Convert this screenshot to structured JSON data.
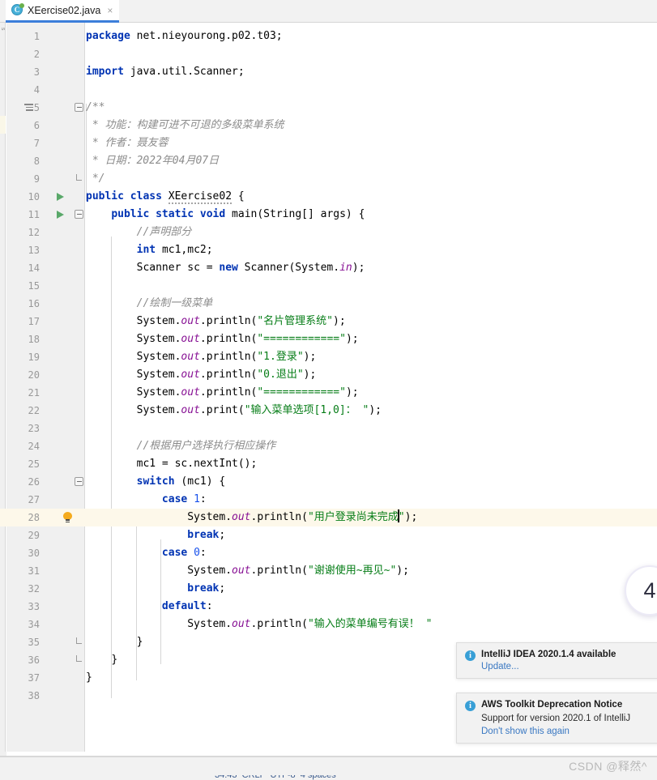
{
  "window": {
    "app": "IntelliJ IDEA"
  },
  "tab": {
    "icon": "java-class-icon",
    "label": "XEercise02.java",
    "close": "×"
  },
  "left_strip": {
    "vertical_text": "s"
  },
  "editor": {
    "current_line": 28,
    "lines": [
      {
        "n": 1,
        "html": "<span class=\"kw\">package</span> <span class=\"pln\">net.nieyourong.p02.t03;</span>"
      },
      {
        "n": 2,
        "html": ""
      },
      {
        "n": 3,
        "html": "<span class=\"kw\">import</span> <span class=\"pln\">java.util.Scanner;</span>"
      },
      {
        "n": 4,
        "html": ""
      },
      {
        "n": 5,
        "html": "<span class=\"cmt\">/**</span>"
      },
      {
        "n": 6,
        "html": "<span class=\"cmt\"> * 功能：构建可进不可退的多级菜单系统</span>"
      },
      {
        "n": 7,
        "html": "<span class=\"cmt\"> * 作者：聂友蓉</span>"
      },
      {
        "n": 8,
        "html": "<span class=\"cmt\"> * 日期：2022年04月07日</span>"
      },
      {
        "n": 9,
        "html": "<span class=\"cmt\"> */</span>"
      },
      {
        "n": 10,
        "html": "<span class=\"kw\">public</span> <span class=\"kw\">class</span> <span class=\"pln wavy\">XEercise02</span> <span class=\"pln\">{</span>"
      },
      {
        "n": 11,
        "html": "    <span class=\"kw\">public</span> <span class=\"kw\">static</span> <span class=\"kw\">void</span> <span class=\"pln\">main(String[] args) {</span>"
      },
      {
        "n": 12,
        "html": "        <span class=\"cmt\">//声明部分</span>"
      },
      {
        "n": 13,
        "html": "        <span class=\"kw\">int</span> <span class=\"pln\">mc1,mc2;</span>"
      },
      {
        "n": 14,
        "html": "        <span class=\"pln\">Scanner sc = </span><span class=\"kw\">new</span><span class=\"pln\"> Scanner(System.</span><span class=\"fld\">in</span><span class=\"pln\">);</span>"
      },
      {
        "n": 15,
        "html": ""
      },
      {
        "n": 16,
        "html": "        <span class=\"cmt\">//绘制一级菜单</span>"
      },
      {
        "n": 17,
        "html": "        <span class=\"pln\">System.</span><span class=\"fld\">out</span><span class=\"pln\">.println(</span><span class=\"str\">\"名片管理系统\"</span><span class=\"pln\">);</span>"
      },
      {
        "n": 18,
        "html": "        <span class=\"pln\">System.</span><span class=\"fld\">out</span><span class=\"pln\">.println(</span><span class=\"str\">\"============\"</span><span class=\"pln\">);</span>"
      },
      {
        "n": 19,
        "html": "        <span class=\"pln\">System.</span><span class=\"fld\">out</span><span class=\"pln\">.println(</span><span class=\"str\">\"1.登录\"</span><span class=\"pln\">);</span>"
      },
      {
        "n": 20,
        "html": "        <span class=\"pln\">System.</span><span class=\"fld\">out</span><span class=\"pln\">.println(</span><span class=\"str\">\"0.退出\"</span><span class=\"pln\">);</span>"
      },
      {
        "n": 21,
        "html": "        <span class=\"pln\">System.</span><span class=\"fld\">out</span><span class=\"pln\">.println(</span><span class=\"str\">\"============\"</span><span class=\"pln\">);</span>"
      },
      {
        "n": 22,
        "html": "        <span class=\"pln\">System.</span><span class=\"fld\">out</span><span class=\"pln\">.print(</span><span class=\"str\">\"输入菜单选项[1,0]： \"</span><span class=\"pln\">);</span>"
      },
      {
        "n": 23,
        "html": ""
      },
      {
        "n": 24,
        "html": "        <span class=\"cmt\">//根据用户选择执行相应操作</span>"
      },
      {
        "n": 25,
        "html": "        <span class=\"pln\">mc1 = sc.nextInt();</span>"
      },
      {
        "n": 26,
        "html": "        <span class=\"kw\">switch</span> <span class=\"pln\">(mc1) {</span>"
      },
      {
        "n": 27,
        "html": "            <span class=\"kw\">case</span> <span class=\"num\">1</span><span class=\"pln\">:</span>"
      },
      {
        "n": 28,
        "html": "                <span class=\"pln\">System.</span><span class=\"fld\">out</span><span class=\"pln\">.println(</span><span class=\"str\">\"用户登录尚未完成</span><span class=\"caret\"></span><span class=\"str\">\"</span><span class=\"pln\">);</span>"
      },
      {
        "n": 29,
        "html": "                <span class=\"kw\">break</span><span class=\"pln\">;</span>"
      },
      {
        "n": 30,
        "html": "            <span class=\"kw\">case</span> <span class=\"num\">0</span><span class=\"pln\">:</span>"
      },
      {
        "n": 31,
        "html": "                <span class=\"pln\">System.</span><span class=\"fld\">out</span><span class=\"pln\">.println(</span><span class=\"str\">\"谢谢使用~再见~\"</span><span class=\"pln\">);</span>"
      },
      {
        "n": 32,
        "html": "                <span class=\"kw\">break</span><span class=\"pln\">;</span>"
      },
      {
        "n": 33,
        "html": "            <span class=\"kw\">default</span><span class=\"pln\">:</span>"
      },
      {
        "n": 34,
        "html": "                <span class=\"pln\">System.</span><span class=\"fld\">out</span><span class=\"pln\">.println(</span><span class=\"str\">\"输入的菜单编号有误！ \"</span>"
      },
      {
        "n": 35,
        "html": "        <span class=\"pln\">}</span>"
      },
      {
        "n": 36,
        "html": "    <span class=\"pln\">}</span>"
      },
      {
        "n": 37,
        "html": "<span class=\"pln\">}</span>"
      },
      {
        "n": 38,
        "html": ""
      }
    ],
    "run_arrow_lines": [
      10,
      11
    ],
    "bulb_lines": [
      28
    ],
    "fold_open_lines": [
      5,
      11,
      26
    ],
    "fold_close_lines": [
      9,
      35,
      36
    ],
    "struct_icon_lines": [
      5
    ]
  },
  "badge": {
    "label": "4"
  },
  "notifications": [
    {
      "id": "intellij-update",
      "icon": "info-icon",
      "title": "IntelliJ IDEA 2020.1.4 available",
      "body": "",
      "link": "Update..."
    },
    {
      "id": "aws-toolkit",
      "icon": "info-icon",
      "title": "AWS Toolkit Deprecation Notice",
      "body": "Support for version 2020.1 of IntelliJ",
      "link": "Don't show this again"
    }
  ],
  "watermark": {
    "text": "CSDN @释然^"
  }
}
